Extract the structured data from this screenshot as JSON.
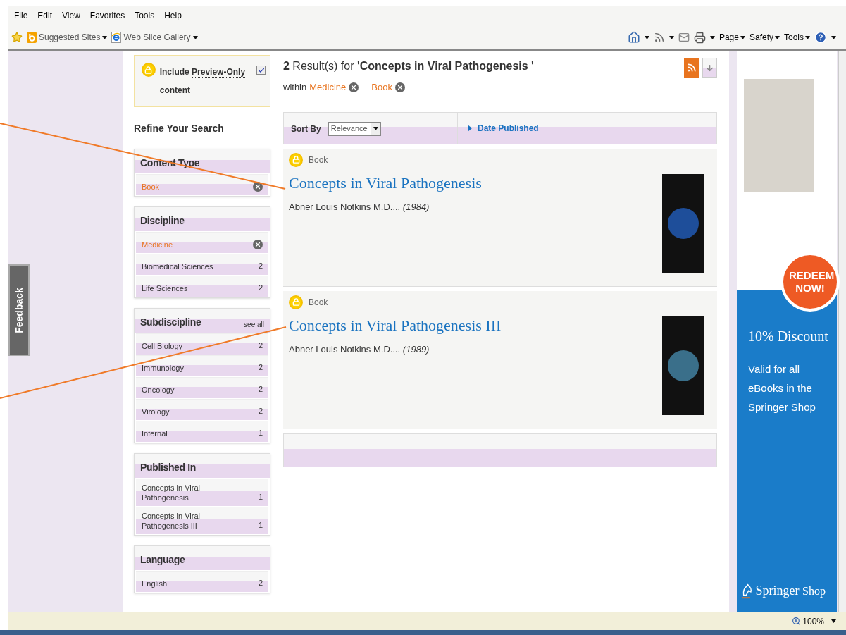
{
  "menu_bar": [
    "File",
    "Edit",
    "View",
    "Favorites",
    "Tools",
    "Help"
  ],
  "favorites_bar": [
    {
      "label": "Suggested Sites",
      "kind": "bing"
    },
    {
      "label": "Web Slice Gallery",
      "kind": "ie"
    }
  ],
  "command_bar": [
    "Page",
    "Safety",
    "Tools"
  ],
  "feedback_tab": "Feedback",
  "preview_box": {
    "prefix": "Include",
    "link": "Preview-Only",
    "suffix": "content",
    "checked": true
  },
  "refine_title": "Refine Your Search",
  "facets": [
    {
      "title": "Content Type",
      "items": [
        {
          "label": "Book",
          "selected": true
        }
      ]
    },
    {
      "title": "Discipline",
      "items": [
        {
          "label": "Medicine",
          "selected": true
        },
        {
          "label": "Biomedical Sciences",
          "count": "2",
          "selected": false
        },
        {
          "label": "Life Sciences",
          "count": "2",
          "selected": false
        }
      ]
    },
    {
      "title": "Subdiscipline",
      "action": "see all",
      "items": [
        {
          "label": "Cell Biology",
          "count": "2",
          "selected": false
        },
        {
          "label": "Immunology",
          "count": "2",
          "selected": false
        },
        {
          "label": "Oncology",
          "count": "2",
          "selected": false
        },
        {
          "label": "Virology",
          "count": "2",
          "selected": false
        },
        {
          "label": "Internal",
          "count": "1",
          "selected": false
        }
      ]
    },
    {
      "title": "Published In",
      "items": [
        {
          "label": "Concepts in Viral Pathogenesis",
          "count": "1",
          "selected": false
        },
        {
          "label": "Concepts in Viral Pathogenesis III",
          "count": "1",
          "selected": false
        }
      ]
    },
    {
      "title": "Language",
      "items": [
        {
          "label": "English",
          "count": "2",
          "selected": false
        }
      ]
    }
  ],
  "results_header": {
    "count": "2",
    "text": "Result(s) for",
    "query": "'Concepts in Viral Pathogenesis '",
    "within": "within",
    "filters": [
      "Medicine",
      "Book"
    ]
  },
  "sort_bar": {
    "label": "Sort By",
    "value": "Relevance",
    "option": "Date Published"
  },
  "results": [
    {
      "type": "Book",
      "title": "Concepts in Viral Pathogenesis",
      "author": "Abner Louis Notkins M.D....",
      "year": "(1984)"
    },
    {
      "type": "Book",
      "title": "Concepts in Viral Pathogenesis III",
      "author": "Abner Louis Notkins M.D....",
      "year": "(1989)"
    }
  ],
  "ad": {
    "badge": "REDEEM NOW!",
    "headline": "10% Discount",
    "text": "Valid for all eBooks in the Springer Shop",
    "brand": "Springer",
    "brand_suffix": "Shop"
  },
  "status_bar": {
    "zoom": "100%"
  }
}
